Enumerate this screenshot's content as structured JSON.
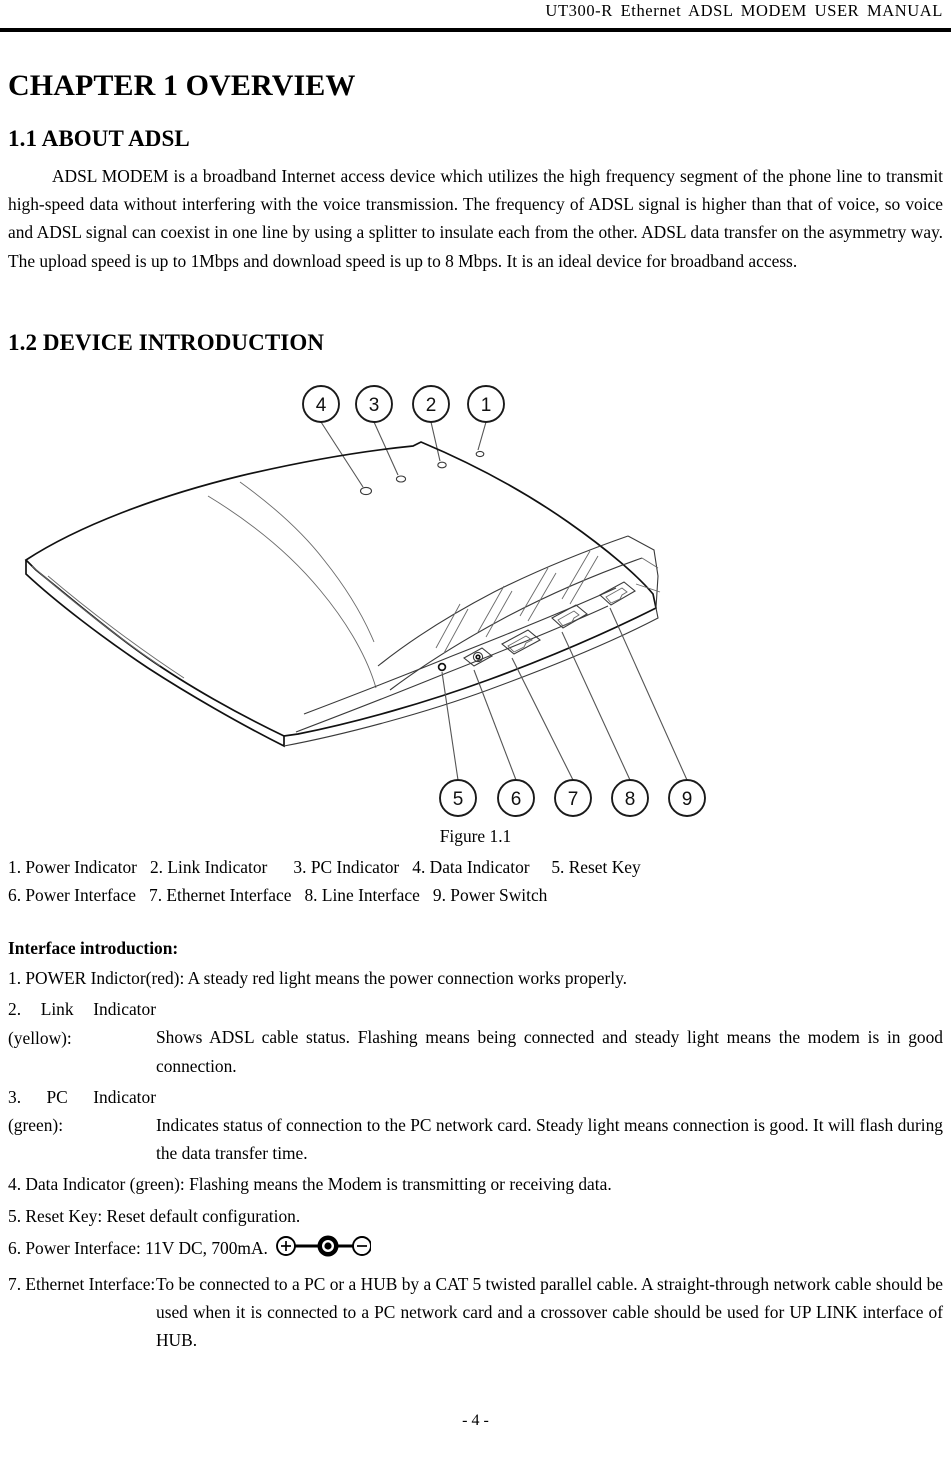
{
  "header": {
    "title": "UT300-R Ethernet ADSL MODEM USER MANUAL"
  },
  "chapter": {
    "title": "CHAPTER 1 OVERVIEW"
  },
  "sections": {
    "about": {
      "heading": "1.1 ABOUT ADSL",
      "paragraph": "ADSL MODEM is a broadband Internet access device  which utilizes the high frequency segment of the phone line to transmit high-speed data without interfering with the voice transmission. The frequency of ADSL signal is higher than that of voice, so voice and ADSL signal can coexist in one line by using a splitter to insulate each from the other. ADSL data transfer on the asymmetry way.   The upload speed is up to 1Mbps and download speed is up to 8 Mbps. It is an ideal device for broadband access."
    },
    "device": {
      "heading": "1.2 DEVICE INTRODUCTION"
    }
  },
  "figure": {
    "caption": "Figure 1.1",
    "callouts": [
      "1",
      "2",
      "3",
      "4",
      "5",
      "6",
      "7",
      "8",
      "9"
    ],
    "legend_line_1": "1. Power Indicator   2. Link Indicator      3. PC Indicator   4. Data Indicator     5. Reset Key",
    "legend_line_2": "6. Power Interface   7. Ethernet Interface   8. Line Interface   9. Power Switch"
  },
  "interface_introduction": {
    "heading": "Interface introduction:",
    "items": [
      {
        "lead": "1. POWER Indictor(red):",
        "text": " A steady red light means the power connection works properly.",
        "flush": true
      },
      {
        "lead": "2. Link Indicator (yellow):",
        "text": "Shows ADSL cable status. Flashing means being connected and steady light means the modem is in good connection.",
        "flush": false
      },
      {
        "lead": "3. PC Indicator (green):",
        "text": "Indicates status of connection to the PC network card. Steady light means connection is good. It will flash during the data transfer time.",
        "flush": false
      },
      {
        "lead": "4. Data Indicator (green):",
        "text": " Flashing means the Modem is transmitting or receiving data.",
        "flush": true
      },
      {
        "lead": "5. Reset Key:",
        "text": " Reset default configuration.",
        "flush": true
      },
      {
        "lead": "6. Power Interface:",
        "text": " 11V DC, 700mA.",
        "flush": true,
        "polarity_symbol": "dc-center-positive"
      },
      {
        "lead": "7. Ethernet Interface:",
        "text": "To be connected to a PC or a HUB by a CAT 5 twisted parallel cable. A straight-through network cable should be used when it is connected to a PC network card and a crossover cable should be used for UP LINK interface of HUB.",
        "flush": false
      }
    ]
  },
  "footer": {
    "page_number": "- 4 -"
  }
}
